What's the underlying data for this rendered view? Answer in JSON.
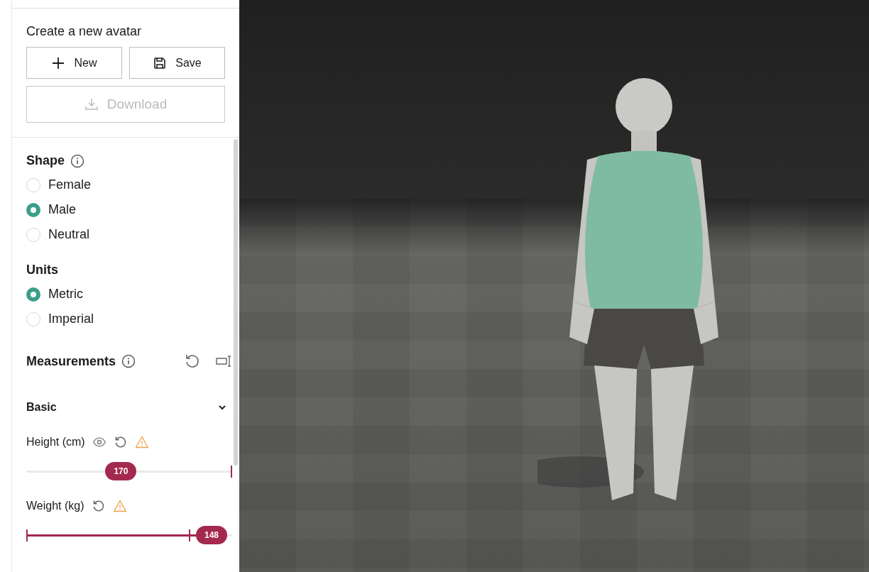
{
  "create": {
    "title": "Create a new avatar",
    "buttons": [
      {
        "label": "New",
        "disabled": false
      },
      {
        "label": "Save",
        "disabled": false
      }
    ],
    "download": {
      "label": "Download",
      "disabled": true
    }
  },
  "shape": {
    "title": "Shape",
    "options": [
      {
        "label": "Female",
        "selected": false
      },
      {
        "label": "Male",
        "selected": true
      },
      {
        "label": "Neutral",
        "selected": false
      }
    ]
  },
  "units": {
    "title": "Units",
    "options": [
      {
        "label": "Metric",
        "selected": true
      },
      {
        "label": "Imperial",
        "selected": false
      }
    ]
  },
  "measurements": {
    "title": "Measurements",
    "group": {
      "title": "Basic",
      "expanded": true
    },
    "sliders": [
      {
        "label": "Height (cm)",
        "visibility_toggle": true,
        "warning": true,
        "filled": false,
        "level": 0.46,
        "reading": "170"
      },
      {
        "label": "Weight (kg)",
        "visibility_toggle": false,
        "warning": true,
        "filled": true,
        "level": 0.9,
        "reading": "148"
      }
    ]
  }
}
